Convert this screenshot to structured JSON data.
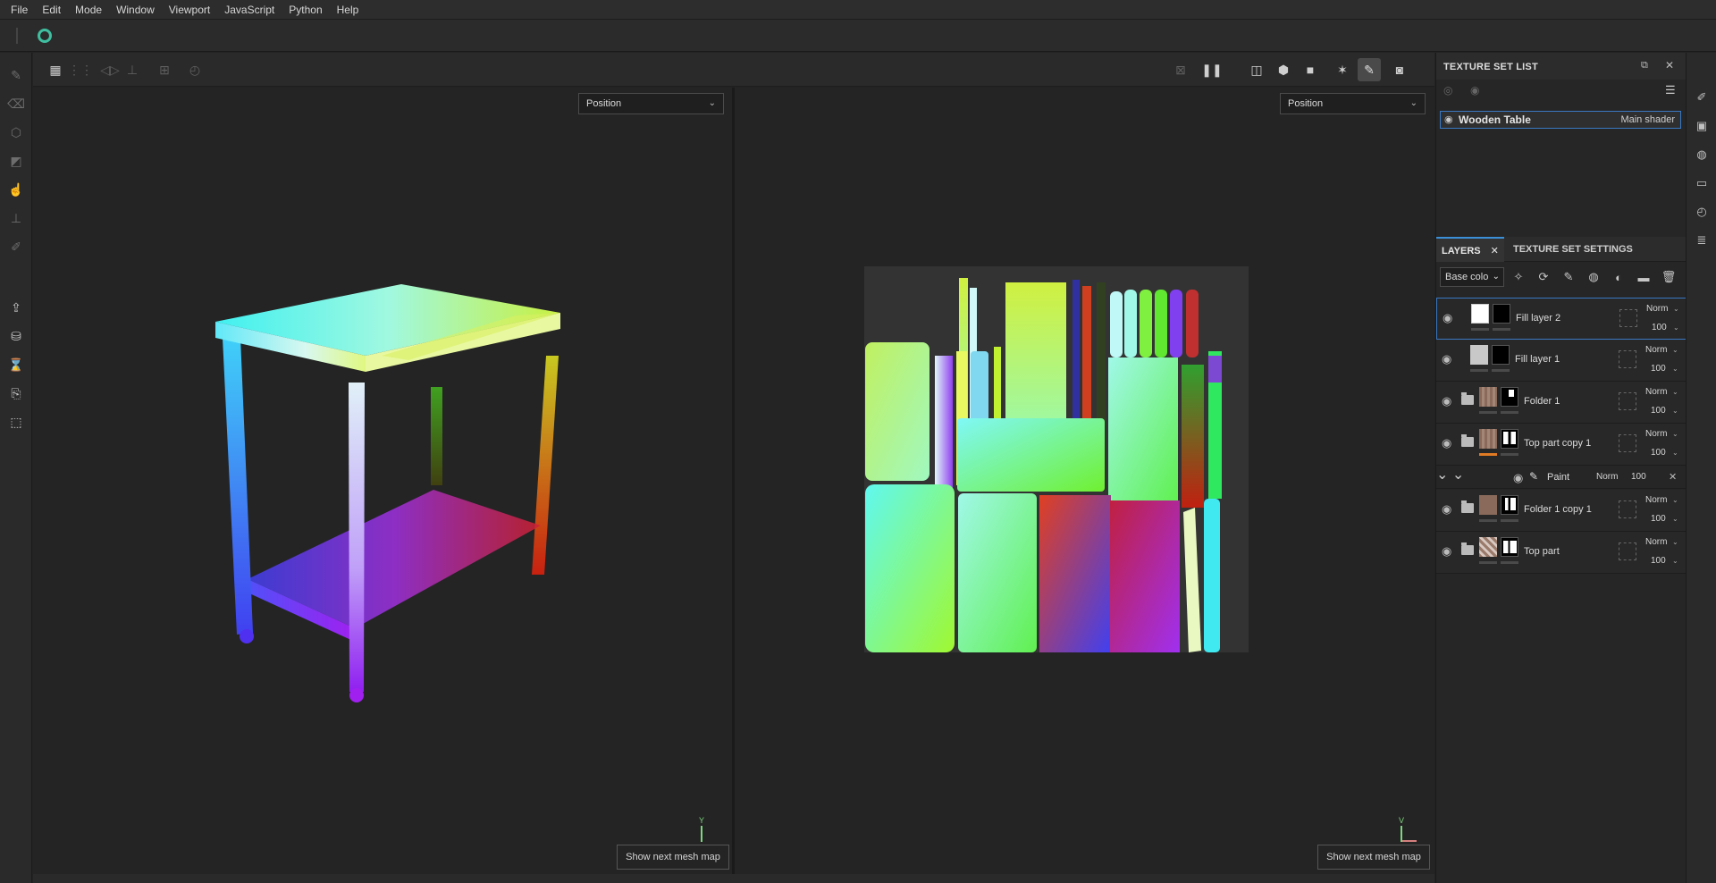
{
  "menu": [
    "File",
    "Edit",
    "Mode",
    "Window",
    "Viewport",
    "JavaScript",
    "Python",
    "Help"
  ],
  "left_tools": [
    "paint-brush-icon",
    "eraser-icon",
    "projection-icon",
    "polygon-fill-icon",
    "smudge-icon",
    "clone-stamp-icon",
    "color-picker-icon",
    "export-icon",
    "bake-icon",
    "iray-icon",
    "resource-icon",
    "shelf-icon"
  ],
  "viewport_3d": {
    "map_select": "Position",
    "show_next_button": "Show next mesh map",
    "axis_label": "Y"
  },
  "viewport_2d": {
    "map_select": "Position",
    "show_next_button": "Show next mesh map",
    "axis_label": "V"
  },
  "texture_set_list": {
    "title": "TEXTURE SET LIST",
    "items": [
      {
        "name": "Wooden Table",
        "shader": "Main shader"
      }
    ]
  },
  "layers_panel": {
    "tabs": [
      "LAYERS",
      "TEXTURE SET SETTINGS"
    ],
    "channel": "Base colo",
    "layers": [
      {
        "name": "Fill layer 2",
        "blend": "Norm",
        "opacity": "100",
        "type": "fill"
      },
      {
        "name": "Fill layer 1",
        "blend": "Norm",
        "opacity": "100",
        "type": "fill"
      },
      {
        "name": "Folder 1",
        "blend": "Norm",
        "opacity": "100",
        "type": "folder"
      },
      {
        "name": "Top part copy 1",
        "blend": "Norm",
        "opacity": "100",
        "type": "folder"
      },
      {
        "name": "Folder 1 copy 1",
        "blend": "Norm",
        "opacity": "100",
        "type": "folder"
      },
      {
        "name": "Top part",
        "blend": "Norm",
        "opacity": "100",
        "type": "folder"
      }
    ],
    "sub_effect": {
      "name": "Paint",
      "blend": "Norm",
      "opacity": "100"
    }
  },
  "colors": {
    "accent": "#3a78c2",
    "orange_marker": "#e07b24",
    "app_icon": "#3fbf9f"
  }
}
